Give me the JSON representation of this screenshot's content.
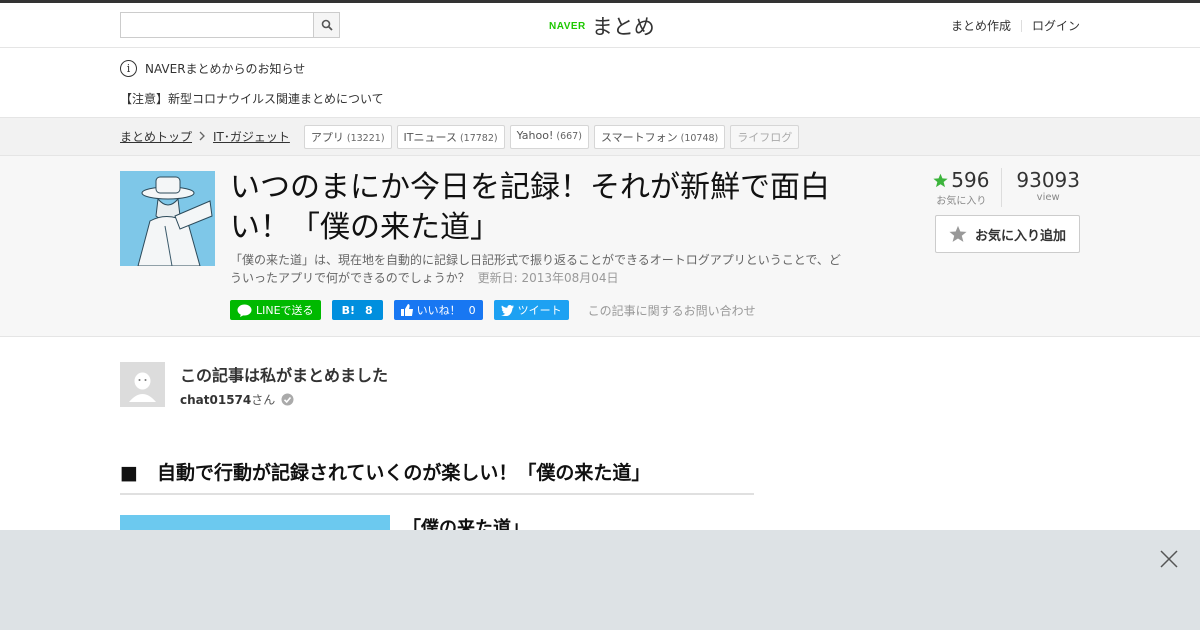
{
  "header": {
    "search_placeholder": "",
    "logo_brand": "NAVER",
    "logo_service": "まとめ",
    "create_link": "まとめ作成",
    "login_link": "ログイン"
  },
  "notice": {
    "heading": "NAVERまとめからのお知らせ",
    "link": "【注意】新型コロナウイルス関連まとめについて"
  },
  "breadcrumb": {
    "items": [
      "まとめトップ",
      "IT･ガジェット"
    ]
  },
  "tags": [
    {
      "label": "アプリ",
      "count": "(13221)"
    },
    {
      "label": "ITニュース",
      "count": "(17782)"
    },
    {
      "label": "Yahoo!",
      "count": "(667)"
    },
    {
      "label": "スマートフォン",
      "count": "(10748)"
    },
    {
      "label": "ライフログ",
      "count": ""
    }
  ],
  "article": {
    "title": "いつのまにか今日を記録！それが新鮮で面白い！「僕の来た道」",
    "description": "「僕の来た道」は、現在地を自動的に記録し日記形式で振り返ることができるオートログアプリということで、どういったアプリで何ができるのでしょうか？",
    "updated": "更新日: 2013年08月04日"
  },
  "share": {
    "line": "LINEで送る",
    "hatena_icon": "B!",
    "hatena_count": "8",
    "facebook_label": "いいね！",
    "facebook_count": "0",
    "tweet": "ツイート",
    "contact": "この記事に関するお問い合わせ"
  },
  "stats": {
    "favorites": "596",
    "favorites_label": "お気に入り",
    "views": "93093",
    "views_label": "view",
    "add_favorite": "お気に入り追加"
  },
  "author": {
    "heading": "この記事は私がまとめました",
    "name": "chat01574",
    "suffix": "さん"
  },
  "content": {
    "section_heading": "■　自動で行動が記録されていくのが楽しい！「僕の来た道」",
    "subheading": "「僕の来た道」"
  },
  "colors": {
    "naver_green": "#1ec800",
    "line_green": "#00b900",
    "hatena_blue": "#008fde",
    "facebook_blue": "#1877f2",
    "twitter_blue": "#1da1f2",
    "star_green": "#3cb43c"
  }
}
